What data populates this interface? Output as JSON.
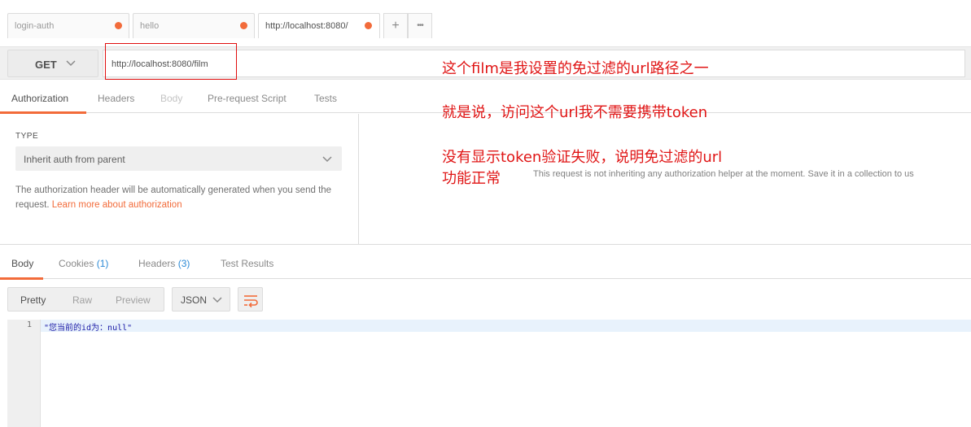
{
  "tabs": [
    {
      "label": "login-auth",
      "unsaved": true
    },
    {
      "label": "hello",
      "unsaved": true
    },
    {
      "label": "http://localhost:8080/",
      "unsaved": true,
      "active": true
    }
  ],
  "tab_actions": {
    "add": "+",
    "more": "•••"
  },
  "request": {
    "method": "GET",
    "url": "http://localhost:8080/film"
  },
  "request_tabs": [
    "Authorization",
    "Headers",
    "Body",
    "Pre-request Script",
    "Tests"
  ],
  "auth": {
    "type_label": "TYPE",
    "selected": "Inherit auth from parent",
    "description": "The authorization header will be automatically generated when you send the request.",
    "link": "Learn more about authorization",
    "right_message": "This request is not inheriting any authorization helper at the moment. Save it in a collection to us"
  },
  "annotations": {
    "line1": "这个film是我设置的免过滤的url路径之一",
    "line2": "就是说，访问这个url我不需要携带token",
    "line3": "没有显示token验证失败，说明免过滤的url",
    "line4": "功能正常"
  },
  "response_tabs": {
    "body": "Body",
    "cookies": "Cookies",
    "cookies_count": "(1)",
    "headers": "Headers",
    "headers_count": "(3)",
    "test_results": "Test Results"
  },
  "view_modes": [
    "Pretty",
    "Raw",
    "Preview"
  ],
  "format": "JSON",
  "editor": {
    "line_number": "1",
    "content": "\"您当前的id为：null\""
  },
  "colors": {
    "accent": "#f26b3a",
    "annotation": "#e01616",
    "link_count": "#2c8ad6"
  }
}
